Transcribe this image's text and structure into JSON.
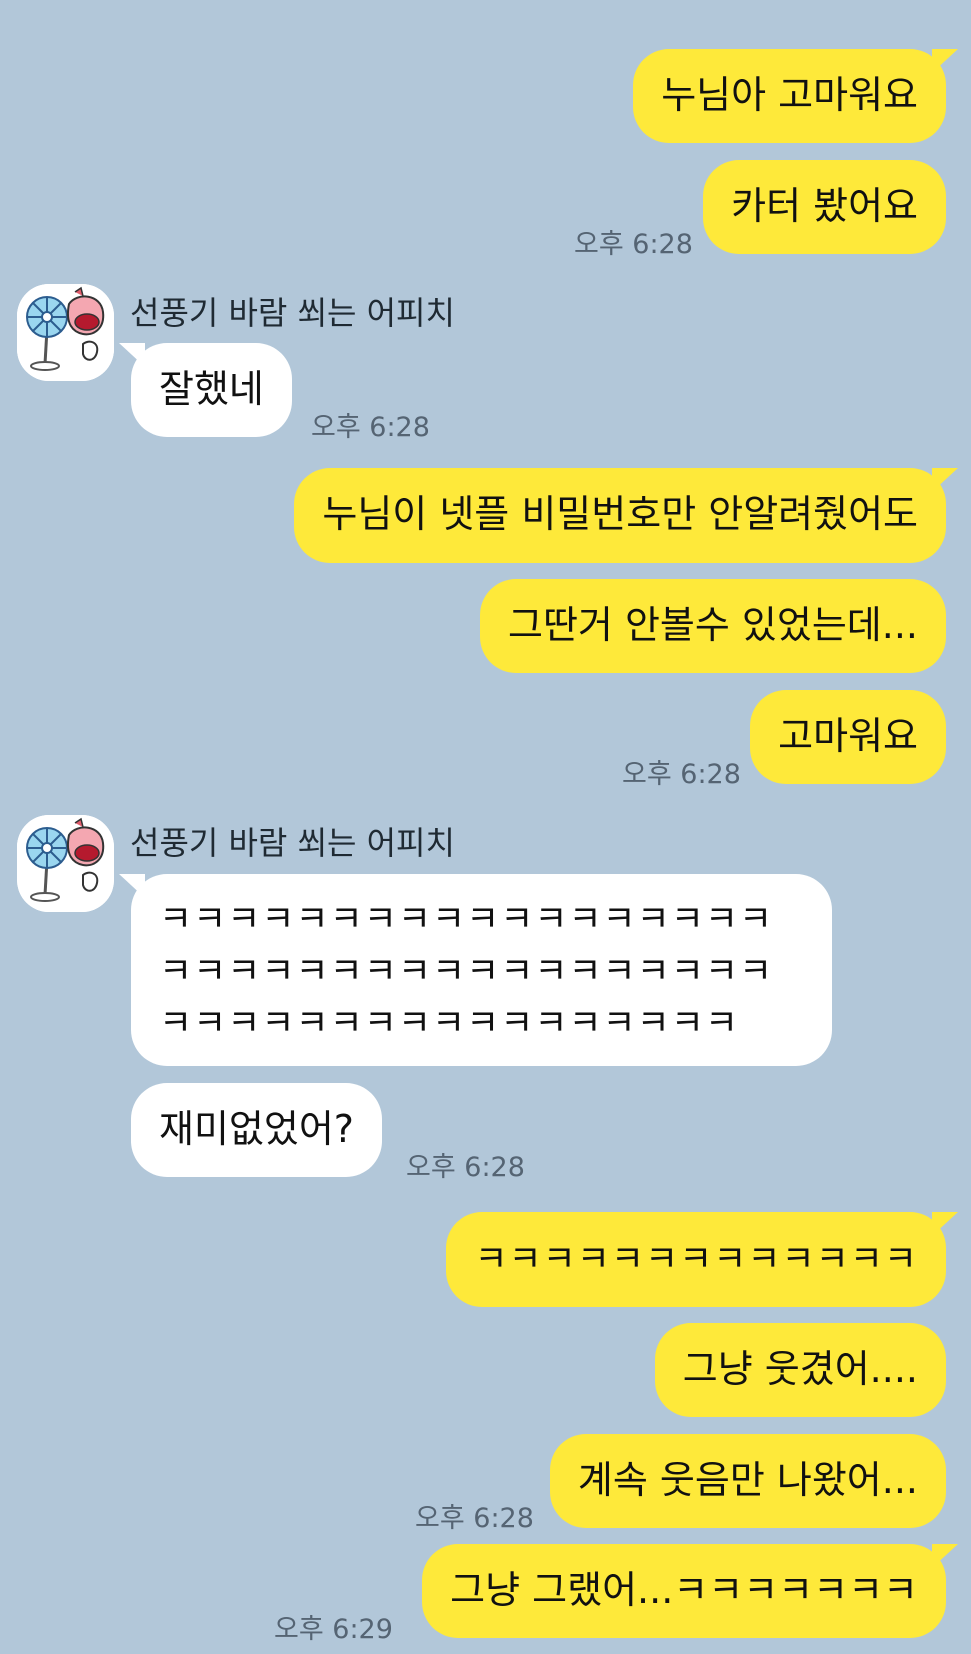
{
  "peer_name": "선풍기 바람 쐬는 어피치",
  "colors": {
    "background": "#b2c7d9",
    "my_bubble": "#fee93a",
    "peer_bubble": "#ffffff"
  },
  "messages": {
    "m1": "누님아 고마워요",
    "m2": "카터 봤어요",
    "t1": "오후 6:28",
    "p1": "잘했네",
    "t2": "오후 6:28",
    "m3": "누님이 넷플 비밀번호만 안알려줬어도",
    "m4": "그딴거 안볼수 있었는데...",
    "m5": "고마워요",
    "t3": "오후 6:28",
    "p2_line1": "ㅋㅋㅋㅋㅋㅋㅋㅋㅋㅋㅋㅋㅋㅋㅋㅋㅋㅋ",
    "p2_line2": "ㅋㅋㅋㅋㅋㅋㅋㅋㅋㅋㅋㅋㅋㅋㅋㅋㅋㅋ",
    "p2_line3": "ㅋㅋㅋㅋㅋㅋㅋㅋㅋㅋㅋㅋㅋㅋㅋㅋㅋ",
    "p3": "재미없었어?",
    "t4": "오후 6:28",
    "m6": "ㅋㅋㅋㅋㅋㅋㅋㅋㅋㅋㅋㅋㅋ",
    "m7": "그냥 웃겼어....",
    "m8": "계속 웃음만 나왔어...",
    "t5": "오후 6:28",
    "m9": "그냥 그랬어...ㅋㅋㅋㅋㅋㅋㅋ",
    "t6": "오후 6:29"
  },
  "icons": {
    "avatar": "apeach-fan-avatar-icon"
  }
}
